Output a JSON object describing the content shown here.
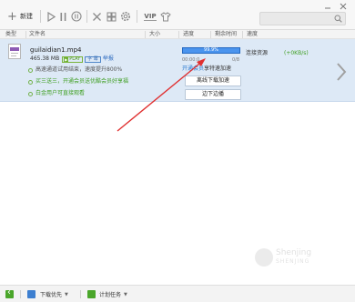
{
  "toolbar": {
    "new_label": "新建",
    "vip_label": "VIP",
    "search_placeholder": ""
  },
  "columns": {
    "type": "类型",
    "filename": "文件名",
    "size": "大小",
    "progress": "进度",
    "remaining": "剩余时间",
    "speed": "速度"
  },
  "task": {
    "filename": "guilaidian1.mp4",
    "size": "465.38 MB",
    "play_badge": "PLAY",
    "subtitle_badge": "字 幕",
    "report_link": "举报",
    "progress_text": "99.9%",
    "progress_value": 0.999,
    "time_elapsed": "00:00:0",
    "ratio": "0/8",
    "vip_open": "开通会员",
    "vip_rest": "享特速加速",
    "offline_button": "离线下载加速",
    "play_button": "边下边播",
    "resource_label": "连接资源",
    "resource_speed": "(+0KB/s)",
    "info_line_1": "高速通道试用结束，速度提升800%",
    "info_line_2": "买三送三，开通会员送优酷会员好享福",
    "info_line_3": "白金用户可直接观看"
  },
  "bottombar": {
    "download_priority": "下载优先",
    "scheduled_tasks": "计划任务"
  },
  "watermark": {
    "brand": "Shenjing",
    "sub": "SHENJING"
  },
  "colors": {
    "selection": "#dde9f6",
    "progress": "#2e7ee0",
    "green": "#3f9f22",
    "link": "#2c7bd0",
    "arrow": "#e03030"
  }
}
